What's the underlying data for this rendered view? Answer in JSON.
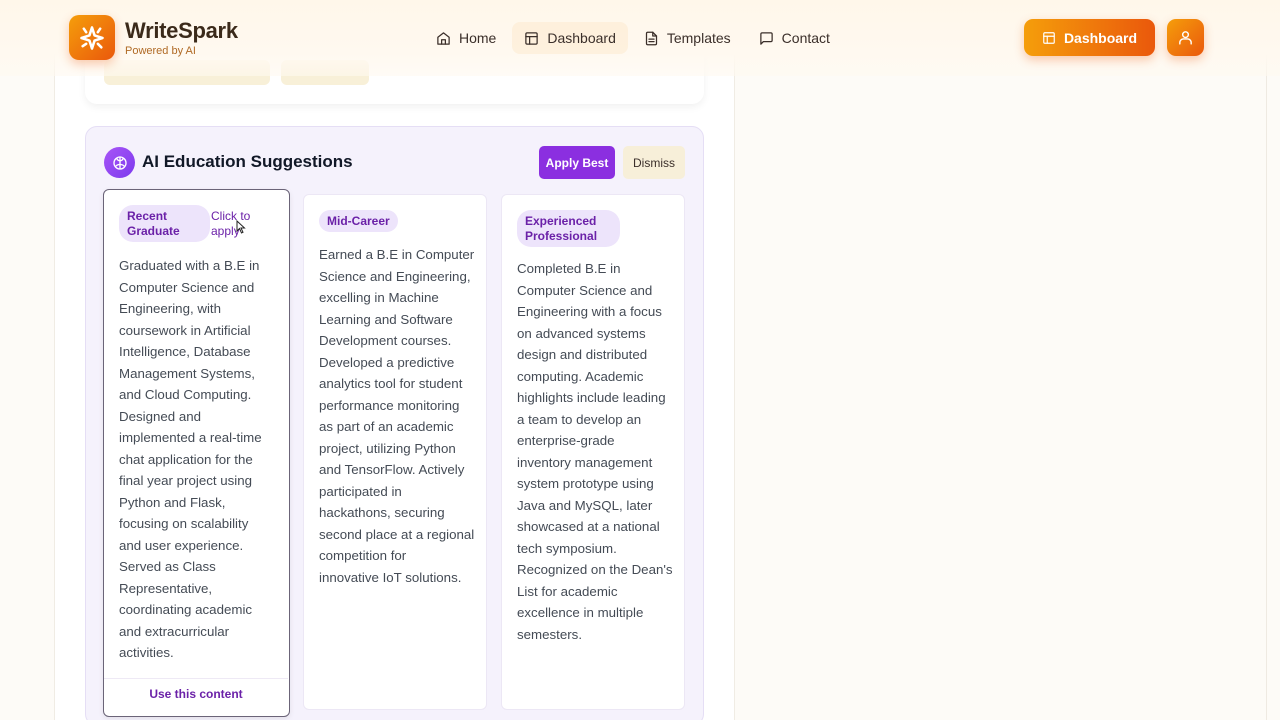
{
  "nav": {
    "brand_name_part1": "Write",
    "brand_name_part2": "Spark",
    "brand_sub": "Powered by AI",
    "links": [
      {
        "label": "Home",
        "icon": "home-icon"
      },
      {
        "label": "Dashboard",
        "icon": "layout-icon"
      },
      {
        "label": "Templates",
        "icon": "file-text-icon"
      },
      {
        "label": "Contact",
        "icon": "message-square-icon"
      }
    ],
    "dashboard_button": "Dashboard",
    "colors": {
      "accent_start": "#f59e0b",
      "accent_end": "#ea580c"
    }
  },
  "suggestions": {
    "title": "AI Education Suggestions",
    "apply_best": "Apply Best",
    "dismiss": "Dismiss",
    "accent": "#8b2fe0",
    "cards": [
      {
        "tag_line1": "Recent",
        "tag_line2": "Graduate",
        "hint_line1": "Click to",
        "hint_line2": "apply",
        "footer": "Use this content",
        "lines": [
          "Graduated with a B.E in",
          "Computer Science and",
          "Engineering, with",
          "coursework in Artificial",
          "Intelligence, Database",
          "Management Systems,",
          "and Cloud Computing.",
          "Designed and",
          "implemented a real-time",
          "chat application for the",
          "final year project using",
          "Python and Flask,",
          "focusing on scalability",
          "and user experience.",
          "Served as Class",
          "Representative,",
          "coordinating academic",
          "and extracurricular",
          "activities."
        ]
      },
      {
        "tag_line1": "Mid-Career",
        "lines": [
          "Earned a B.E in Computer",
          "Science and Engineering,",
          "excelling in Machine",
          "Learning and Software",
          "Development courses.",
          "Developed a predictive",
          "analytics tool for student",
          "performance monitoring",
          "as part of an academic",
          "project, utilizing Python",
          "and TensorFlow. Actively",
          "participated in",
          "hackathons, securing",
          "second place at a regional",
          "competition for",
          "innovative IoT solutions."
        ]
      },
      {
        "tag_line1": "Experienced",
        "tag_line2": "Professional",
        "lines": [
          "Completed B.E in",
          "Computer Science and",
          "Engineering with a focus",
          "on advanced systems",
          "design and distributed",
          "computing. Academic",
          "highlights include leading",
          "a team to develop an",
          "enterprise-grade",
          "inventory management",
          "system prototype using",
          "Java and MySQL, later",
          "showcased at a national",
          "tech symposium.",
          "Recognized on the Dean's",
          "List for academic",
          "excellence in multiple",
          "semesters."
        ]
      }
    ]
  }
}
